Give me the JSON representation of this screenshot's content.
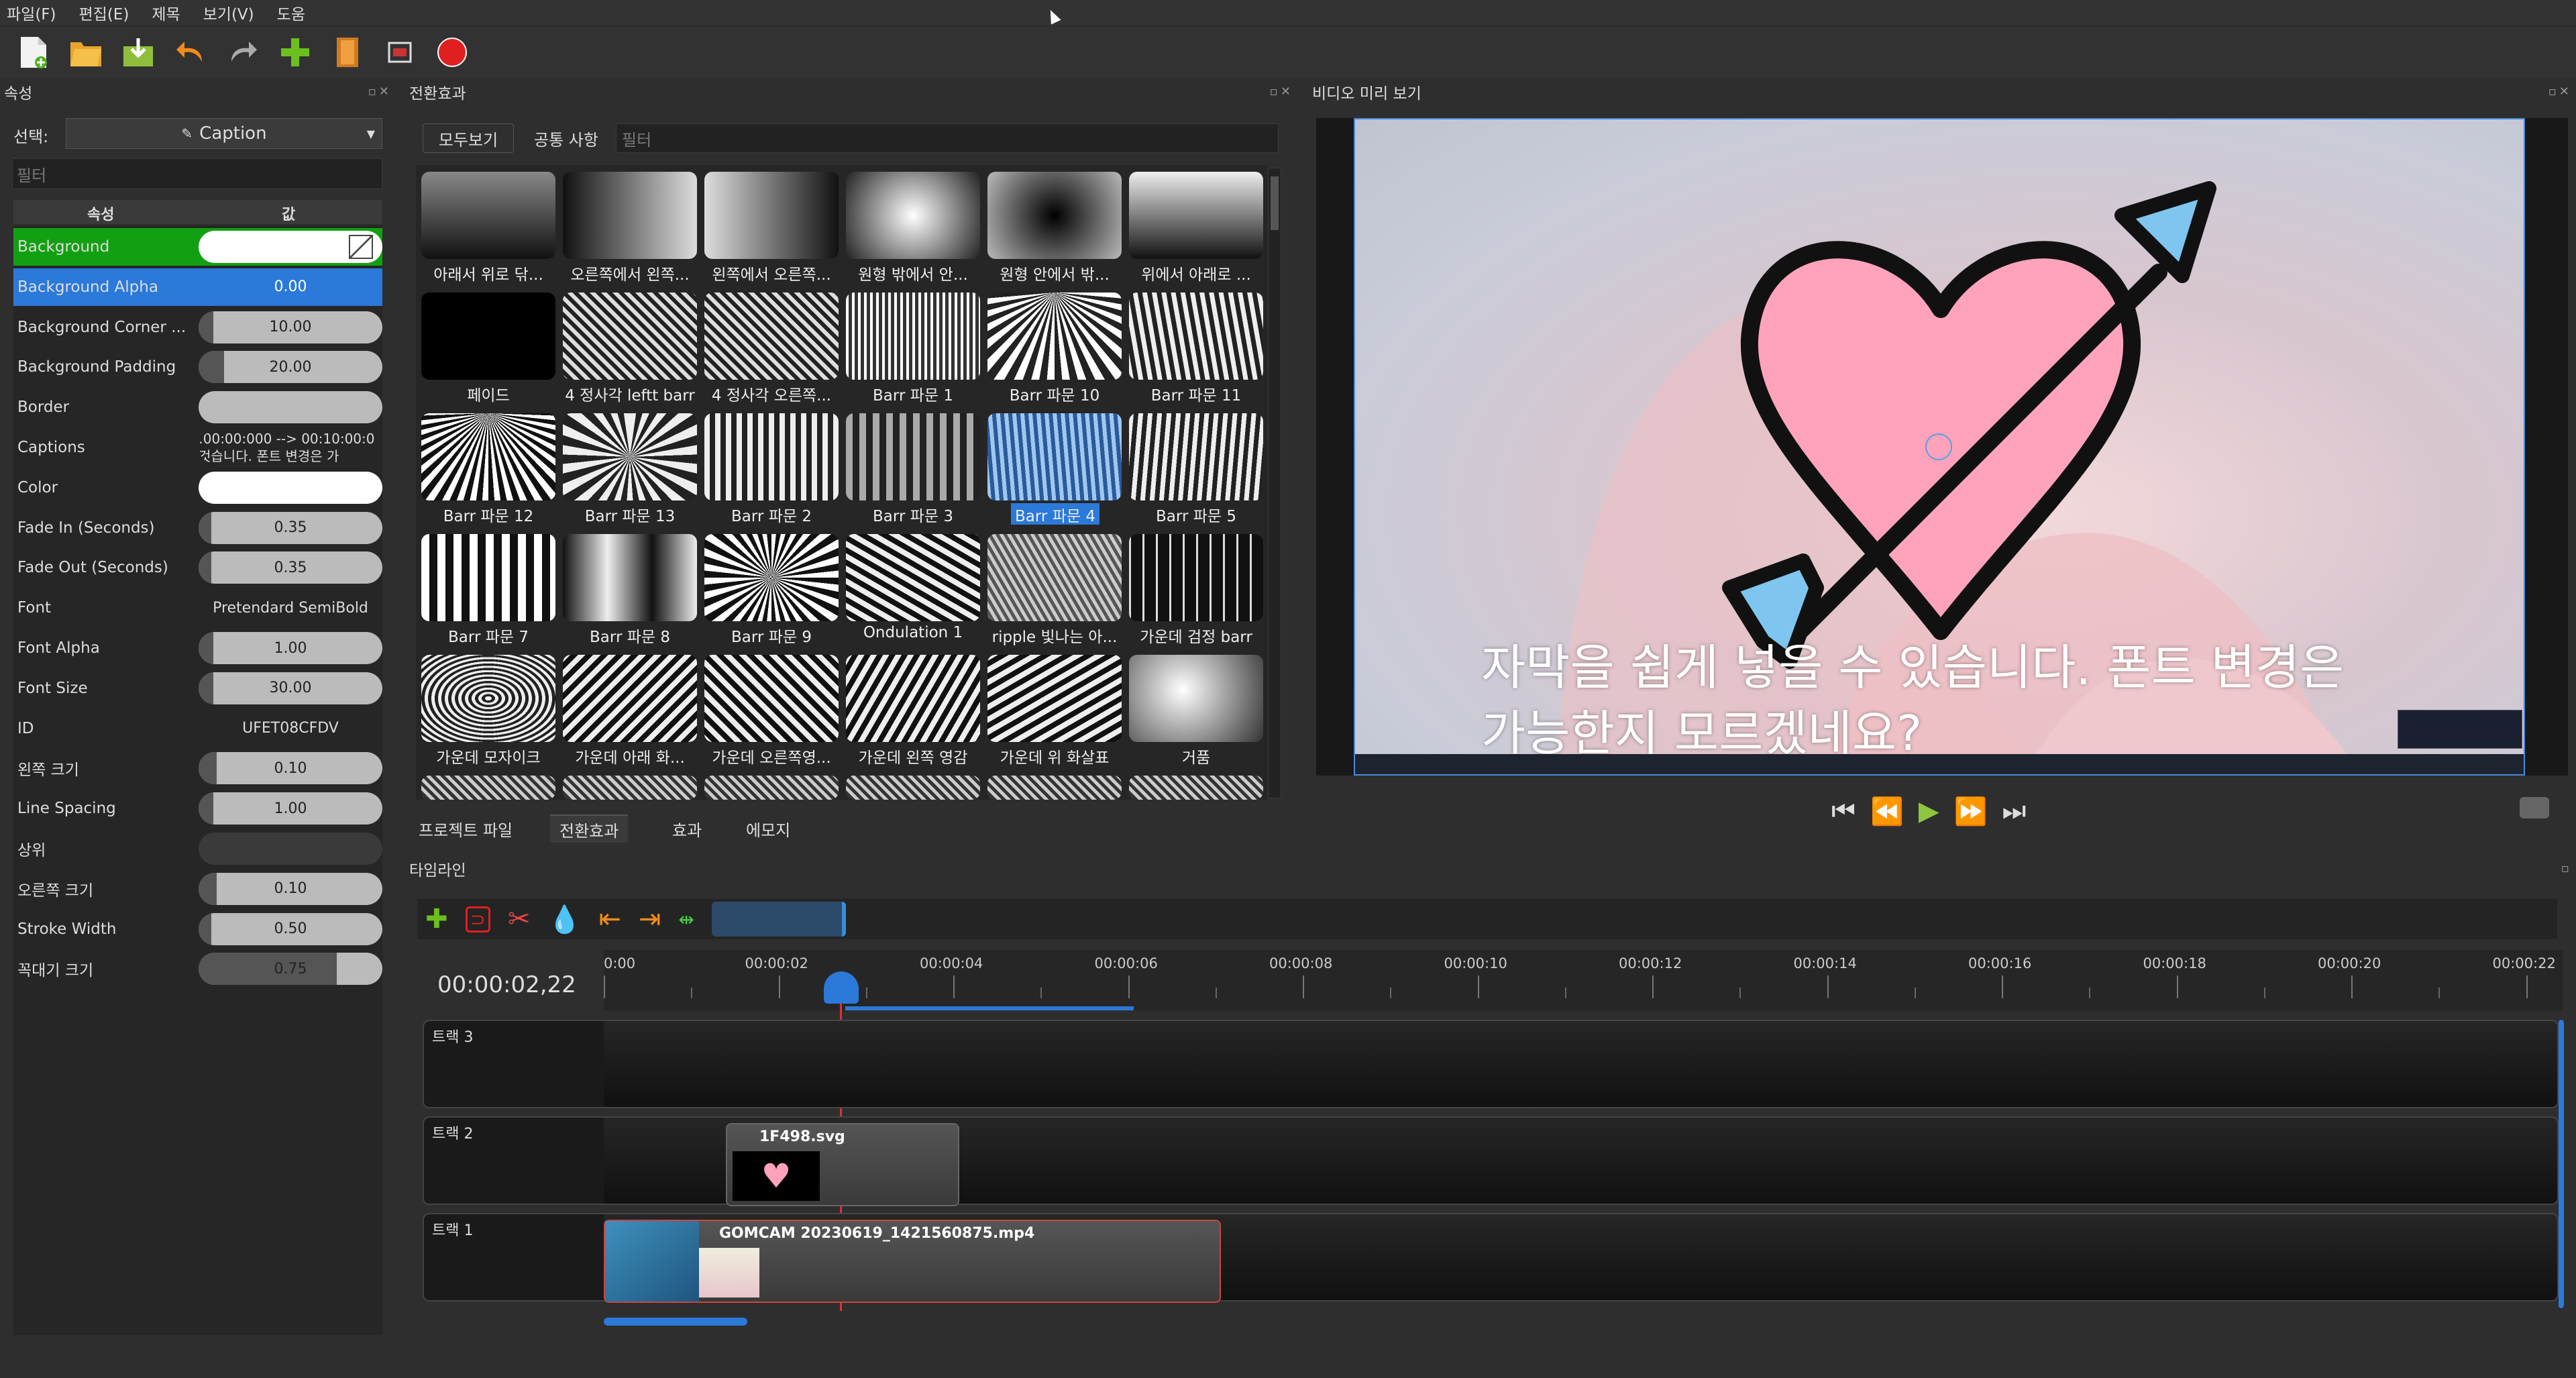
{
  "menu": [
    "파일(F)",
    "편집(E)",
    "제목",
    "보기(V)",
    "도움"
  ],
  "properties": {
    "title": "속성",
    "select_label": "선택:",
    "select_value": "Caption",
    "filter_placeholder": "필터",
    "col_name": "속성",
    "col_value": "값",
    "rows": [
      {
        "name": "Background",
        "value": "",
        "bg": "#12a012",
        "kind": "color",
        "fill": 0
      },
      {
        "name": "Background Alpha",
        "value": "0.00",
        "bg": "#2b79d8",
        "kind": "num",
        "fill": 0
      },
      {
        "name": "Background Corner ...",
        "value": "10.00",
        "bg": "",
        "kind": "num",
        "fill": 0.08
      },
      {
        "name": "Background Padding",
        "value": "20.00",
        "bg": "",
        "kind": "num",
        "fill": 0.14
      },
      {
        "name": "Border",
        "value": "",
        "bg": "",
        "kind": "plain",
        "fill": 0
      },
      {
        "name": "Captions",
        "value": ":00:00:000 --> 00:10:00:0 것습니다. 폰트 변경은 가",
        "bg": "",
        "kind": "text",
        "fill": 0
      },
      {
        "name": "Color",
        "value": "",
        "bg": "",
        "kind": "white",
        "fill": 0
      },
      {
        "name": "Fade In (Seconds)",
        "value": "0.35",
        "bg": "",
        "kind": "num",
        "fill": 0.06
      },
      {
        "name": "Fade Out (Seconds)",
        "value": "0.35",
        "bg": "",
        "kind": "num",
        "fill": 0.06
      },
      {
        "name": "Font",
        "value": "Pretendard SemiBold",
        "bg": "",
        "kind": "dark",
        "fill": 0
      },
      {
        "name": "Font Alpha",
        "value": "1.00",
        "bg": "",
        "kind": "num",
        "fill": 0.08
      },
      {
        "name": "Font Size",
        "value": "30.00",
        "bg": "",
        "kind": "num",
        "fill": 0.08
      },
      {
        "name": "ID",
        "value": "UFET08CFDV",
        "bg": "",
        "kind": "dark",
        "fill": 0
      },
      {
        "name": "왼쪽 크기",
        "value": "0.10",
        "bg": "",
        "kind": "num",
        "fill": 0.1
      },
      {
        "name": "Line Spacing",
        "value": "1.00",
        "bg": "",
        "kind": "num",
        "fill": 0.08
      },
      {
        "name": "상위",
        "value": "",
        "bg": "",
        "kind": "darkplain",
        "fill": 0
      },
      {
        "name": "오른쪽 크기",
        "value": "0.10",
        "bg": "",
        "kind": "num",
        "fill": 0.1
      },
      {
        "name": "Stroke Width",
        "value": "0.50",
        "bg": "",
        "kind": "num",
        "fill": 0.03
      },
      {
        "name": "꼭대기 크기",
        "value": "0.75",
        "bg": "",
        "kind": "num",
        "fill": 0.75
      }
    ]
  },
  "transitions": {
    "title": "전환효과",
    "view_all": "모두보기",
    "common": "공통 사항",
    "filter_placeholder": "필터",
    "items": [
      "아래서 위로 닦...",
      "오른쪽에서 왼쪽...",
      "왼쪽에서 오른쪽...",
      "원형 밖에서 안...",
      "원형 안에서 밖...",
      "위에서 아래로 ...",
      "페이드",
      "4 정사각 leftt barr",
      "4 정사각 오른쪽...",
      "Barr 파문 1",
      "Barr 파문 10",
      "Barr 파문 11",
      "Barr 파문 12",
      "Barr 파문 13",
      "Barr 파문 2",
      "Barr 파문 3",
      "Barr 파문 4",
      "Barr 파문 5",
      "Barr 파문 7",
      "Barr 파문 8",
      "Barr 파문 9",
      "Ondulation 1",
      "ripple 빛나는 아...",
      "가운데 검정 barr",
      "가운데 모자이크",
      "가운데 아래 화...",
      "가운데 오른쪽영...",
      "가운데 왼쪽 영감",
      "가운데 위 화살표",
      "거품"
    ],
    "selected": "Barr 파문 4",
    "tabs": [
      "프로젝트 파일",
      "전환효과",
      "효과",
      "에모지"
    ]
  },
  "preview": {
    "title": "비디오 미리 보기",
    "caption_line1": "자막을 쉽게 넣을 수 있습니다. 폰트 변경은",
    "caption_line2": "가능한지 모르겠네요?"
  },
  "timeline": {
    "title": "타임라인",
    "timecode": "00:00:02,22",
    "ruler": [
      "0:00",
      "00:00:02",
      "00:00:04",
      "00:00:06",
      "00:00:08",
      "00:00:10",
      "00:00:12",
      "00:00:14",
      "00:00:16",
      "00:00:18",
      "00:00:20",
      "00:00:22"
    ],
    "tracks": [
      "트랙 3",
      "트랙 2",
      "트랙 1"
    ],
    "clip_svg": "1F498.svg",
    "clip_video": "GOMCAM 20230619_1421560875.mp4"
  },
  "colors": {
    "selected": "#2b79d8",
    "background_row": "#12a012",
    "heart": "#ff9fb8",
    "arrow_blue": "#7cc4f2",
    "playhead": "#e0303a"
  }
}
